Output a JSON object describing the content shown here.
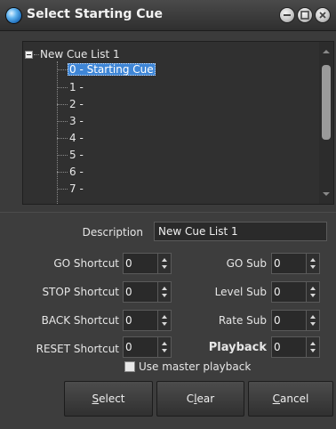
{
  "window": {
    "title": "Select Starting Cue",
    "buttons": [
      "minimize",
      "maximize",
      "close"
    ]
  },
  "tree": {
    "root_label": "New Cue List 1",
    "items": [
      "0 - Starting Cue",
      "1 -",
      "2 -",
      "3 -",
      "4 -",
      "5 -",
      "6 -",
      "7 -"
    ],
    "selected_index": 0
  },
  "form": {
    "description_label": "Description",
    "description_value": "New Cue List 1",
    "go_shortcut_label": "GO Shortcut",
    "go_shortcut_value": "0",
    "stop_shortcut_label": "STOP Shortcut",
    "stop_shortcut_value": "0",
    "back_shortcut_label": "BACK Shortcut",
    "back_shortcut_value": "0",
    "reset_shortcut_label": "RESET Shortcut",
    "reset_shortcut_value": "0",
    "go_sub_label": "GO Sub",
    "go_sub_value": "0",
    "level_sub_label": "Level Sub",
    "level_sub_value": "0",
    "rate_sub_label": "Rate Sub",
    "rate_sub_value": "0",
    "playback_label": "Playback",
    "playback_value": "0",
    "use_master_label": "Use master playback",
    "use_master_checked": false
  },
  "buttons": {
    "select": {
      "label": "Select",
      "mnemonic": "S",
      "rest": "elect"
    },
    "clear": {
      "label": "Clear",
      "pre": "C",
      "mnemonic": "l",
      "rest": "ear"
    },
    "cancel": {
      "label": "Cancel",
      "mnemonic": "C",
      "rest": "ancel"
    }
  }
}
